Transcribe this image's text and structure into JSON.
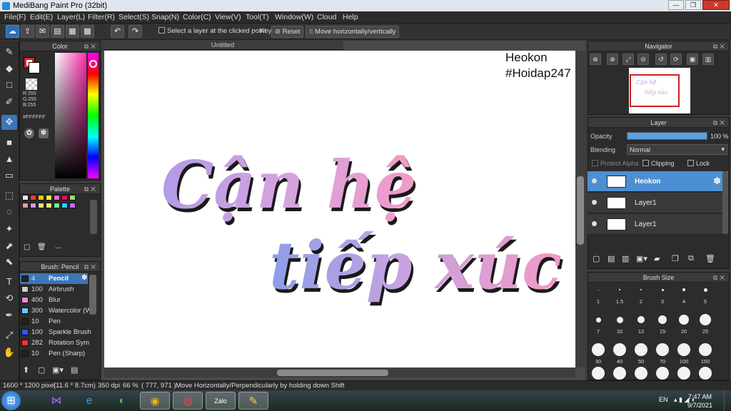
{
  "window": {
    "title": "MediBang Paint Pro (32bit)",
    "min": "—",
    "max": "❐",
    "close": "✕"
  },
  "menu": [
    "File(F)",
    "Edit(E)",
    "Layer(L)",
    "Filter(R)",
    "Select(S)",
    "Snap(N)",
    "Color(C)",
    "View(V)",
    "Tool(T)",
    "Window(W)",
    "Cloud",
    "Help"
  ],
  "toolbar": {
    "select_layer_label": "Select a layer at the clicked point",
    "key_label": "Key",
    "reset_label": "Reset",
    "move_label": "Move horizontally/vertically"
  },
  "color_panel": {
    "title": "Color",
    "r": "R:255",
    "g": "G:255",
    "b": "B:255",
    "hex": "#FFFFFF"
  },
  "palette_panel": {
    "title": "Palette",
    "value": "---",
    "swatches": [
      "#e8e8e8",
      "#ff3b3b",
      "#ffcc00",
      "#ffff33",
      "#ff66cc",
      "#ff0066",
      "#99dd66",
      "#ff9999",
      "#cc99ff",
      "#ffdd88",
      "#ffee66",
      "#66ff99",
      "#33ccff",
      "#cc66ff"
    ]
  },
  "brush_panel": {
    "title": "Brush: Pencil",
    "brushes": [
      {
        "size": "4",
        "name": "Pencil",
        "color": "#222222"
      },
      {
        "size": "100",
        "name": "Airbrush",
        "color": "#cccccc"
      },
      {
        "size": "400",
        "name": "Blur",
        "color": "#ff88cc"
      },
      {
        "size": "300",
        "name": "Watercolor (W",
        "color": "#66ccff"
      },
      {
        "size": "10",
        "name": "Pen",
        "color": "#222222"
      },
      {
        "size": "100",
        "name": "Sparkle Brush",
        "color": "#3355ff"
      },
      {
        "size": "282",
        "name": "Rotation Sym",
        "color": "#ff3333"
      },
      {
        "size": "10",
        "name": "Pen (Sharp)",
        "color": "#222222"
      }
    ]
  },
  "document": {
    "tab_title": "Untitled",
    "watermark_line1": "Heokon",
    "watermark_line2": "#Hoidap247",
    "artwork_line1": "Cận hệ",
    "artwork_line2": "tiếp xúc"
  },
  "navigator": {
    "title": "Navigator"
  },
  "layer_panel": {
    "title": "Layer",
    "opacity_label": "Opacity",
    "opacity_value": "100 %",
    "opacity_fraction": 1.0,
    "blending_label": "Blending",
    "blending_value": "Normal",
    "protect_alpha": "Protect Alpha",
    "clipping": "Clipping",
    "lock": "Lock",
    "layers": [
      {
        "name": "Heokon",
        "selected": true
      },
      {
        "name": "Layer1",
        "selected": false
      },
      {
        "name": "Layer1",
        "selected": false
      }
    ]
  },
  "brush_size_panel": {
    "title": "Brush Size",
    "sizes": [
      "1",
      "1.5",
      "2",
      "3",
      "4",
      "5",
      "7",
      "10",
      "12",
      "15",
      "20",
      "25",
      "30",
      "40",
      "50",
      "70",
      "100",
      "150"
    ]
  },
  "status": {
    "dimensions": "1600 * 1200 pixel",
    "physical": "(11.6 * 8.7cm)",
    "dpi": "350 dpi",
    "zoom": "66 %",
    "coords": "( 777, 971 )",
    "hint": "Move Horizontally/Perpendicularly by holding down Shift"
  },
  "taskbar": {
    "lang": "EN",
    "time": "7:47 AM",
    "date": "9/7/2021",
    "zalo": "Zalo"
  }
}
